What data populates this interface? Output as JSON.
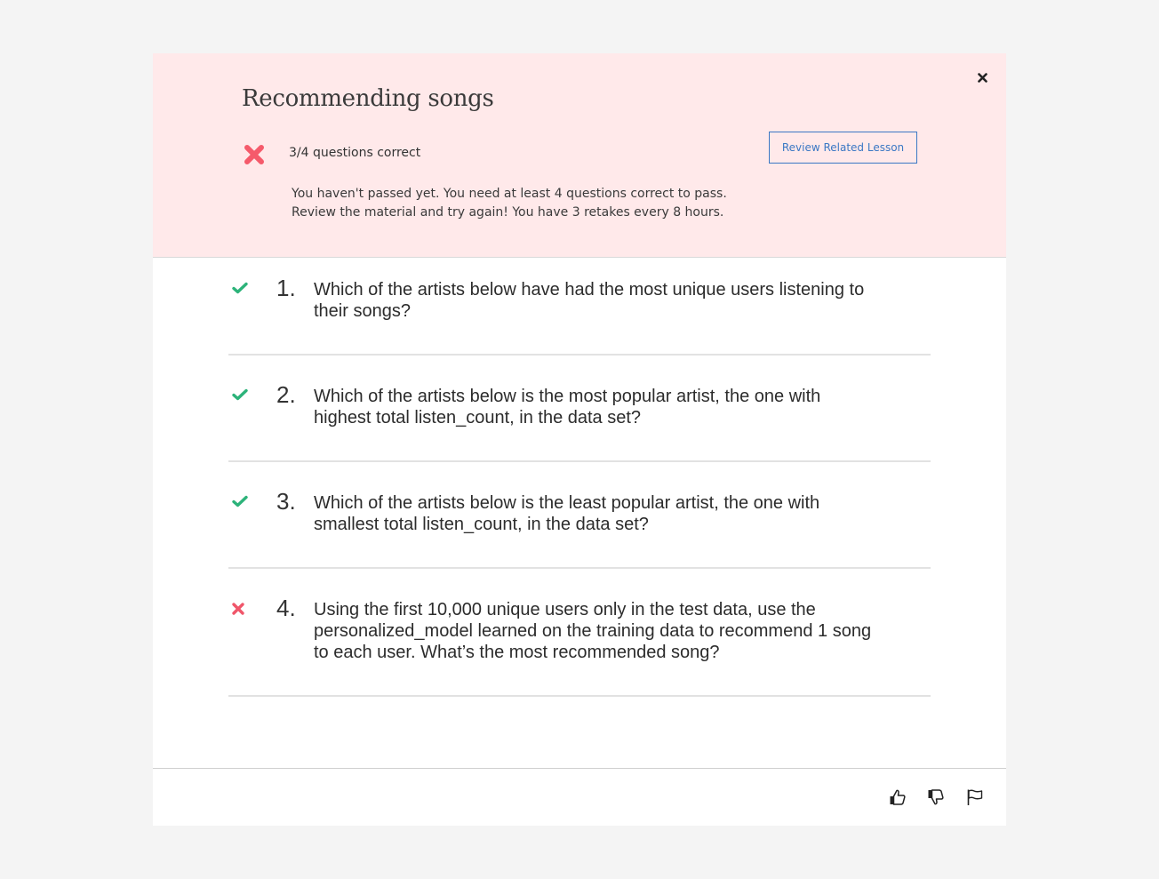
{
  "quiz": {
    "title": "Recommending songs",
    "close_icon": "close-icon",
    "result": {
      "status": "failed",
      "status_icon": "fail-x-icon",
      "score_text": "3/4 questions correct",
      "correct": 3,
      "total": 4,
      "message_line1": "You haven't passed yet. You need at least 4 questions correct to pass.",
      "message_line2": "Review the material and try again! You have 3 retakes every 8 hours."
    },
    "review_button_label": "Review Related Lesson",
    "colors": {
      "banner_bg": "#ffe9ea",
      "correct": "#2db37a",
      "incorrect": "#f0566a",
      "link": "#3b78c4"
    }
  },
  "questions": [
    {
      "number": "1.",
      "status": "correct",
      "status_icon": "check-icon",
      "text": "Which of the artists below have had the most unique users listening to their songs?"
    },
    {
      "number": "2.",
      "status": "correct",
      "status_icon": "check-icon",
      "text": "Which of the artists below is the most popular artist, the one with highest total listen_count, in the data set?"
    },
    {
      "number": "3.",
      "status": "correct",
      "status_icon": "check-icon",
      "text": "Which of the artists below is the least popular artist, the one with smallest total listen_count, in the data set?"
    },
    {
      "number": "4.",
      "status": "incorrect",
      "status_icon": "x-icon",
      "text": "Using the first 10,000 unique users only in the test data, use the personalized_model learned on the training data to recommend 1 song to each user. What’s the most recommended song?"
    }
  ],
  "footer": {
    "actions": [
      {
        "name": "thumbs-up",
        "icon": "thumbs-up-icon"
      },
      {
        "name": "thumbs-down",
        "icon": "thumbs-down-icon"
      },
      {
        "name": "flag",
        "icon": "flag-icon"
      }
    ]
  }
}
